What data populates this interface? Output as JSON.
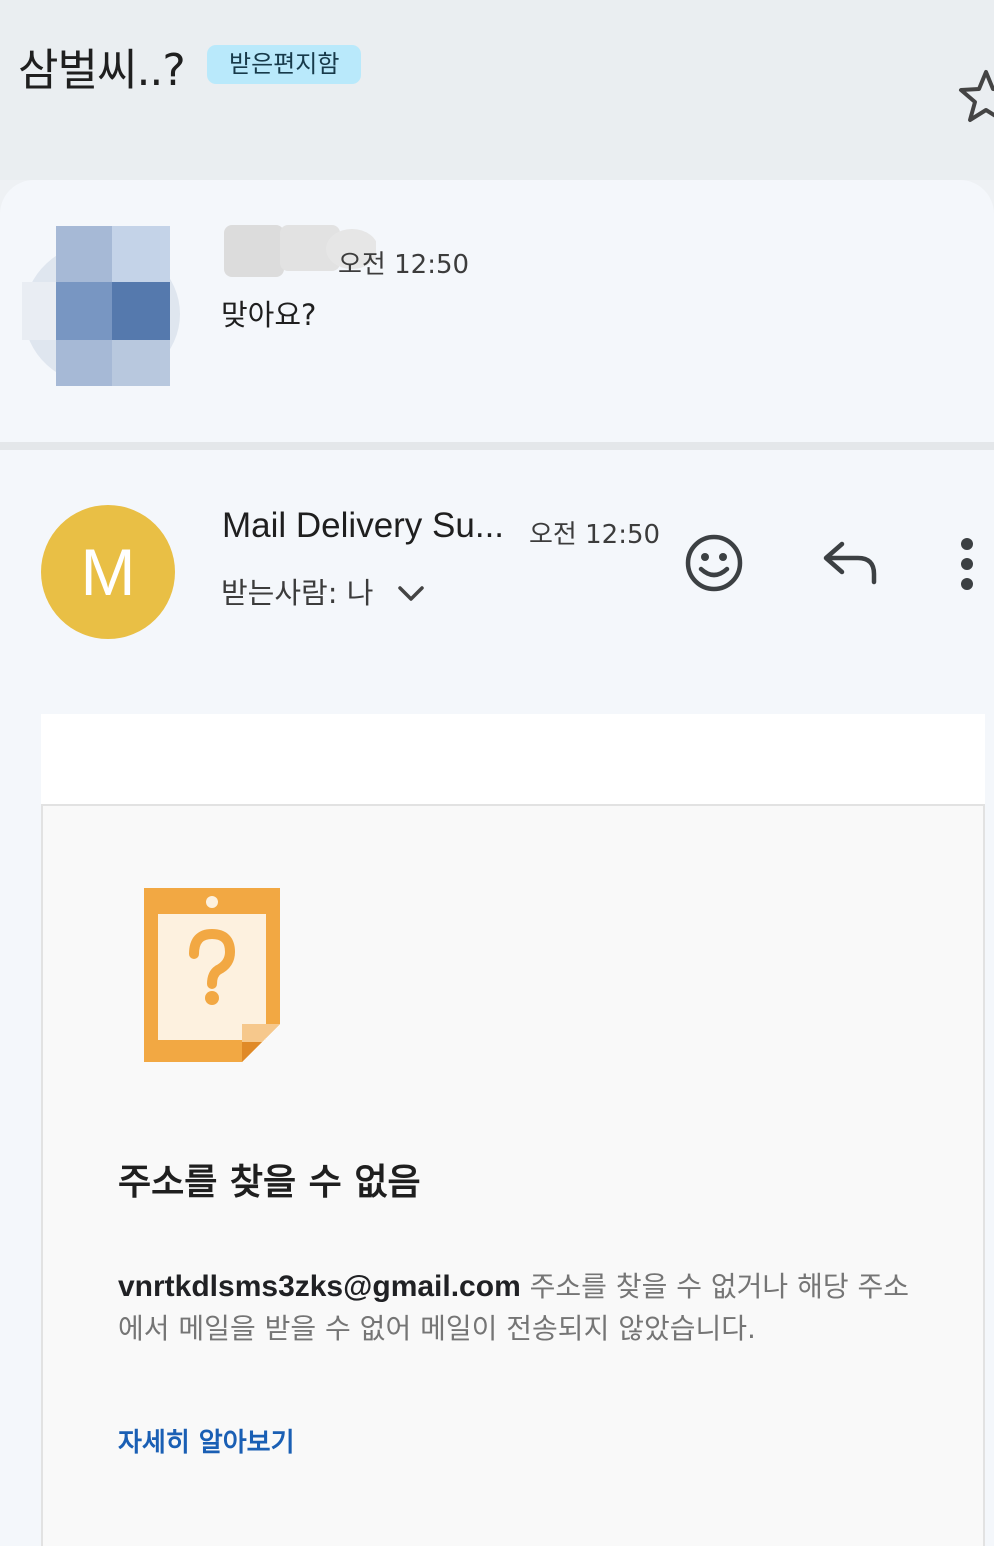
{
  "thread": {
    "subject": "삼벌씨..?",
    "label": "받은편지함"
  },
  "message1": {
    "time": "오전 12:50",
    "snippet": "맞아요?"
  },
  "message2": {
    "avatar_letter": "M",
    "sender": "Mail Delivery Su...",
    "time": "오전 12:50",
    "recipient": "받는사람: 나"
  },
  "bounce": {
    "title": "주소를 찾을 수 없음",
    "email": "vnrtkdlsms3zks@gmail.com",
    "message_line1": " 주소를 찾을 수 없거나 해당 주소",
    "message_line2": "에서 메일을 받을 수 없어 메일이 전송되지 않았습니다.",
    "link": "자세히 알아보기"
  },
  "colors": {
    "avatar": "#e9bf45",
    "label_chip": "#b9e9fb",
    "link": "#1a5fb4",
    "doc_icon": "#f2a843"
  }
}
